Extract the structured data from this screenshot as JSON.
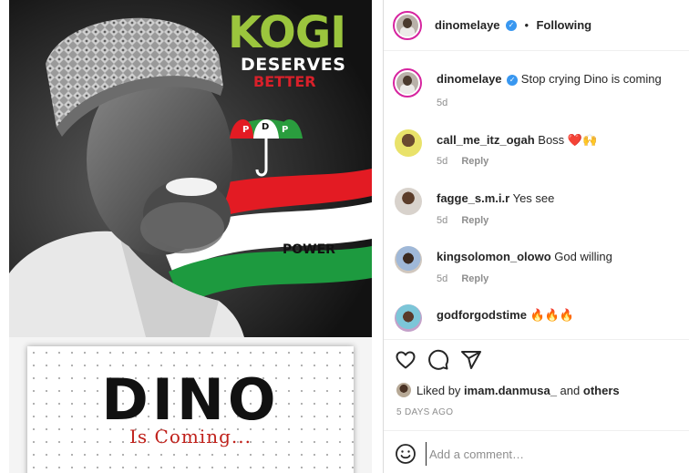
{
  "poster": {
    "headline_1": "KOGI",
    "headline_2": "DESERVES",
    "headline_3": "BETTER",
    "party": "PDP",
    "power_label": "POWER",
    "bottom_title": "DINO",
    "bottom_subtitle": "Is Coming..."
  },
  "header": {
    "username": "dinomelaye",
    "separator": "•",
    "follow_status": "Following",
    "verified": true
  },
  "caption": {
    "username": "dinomelaye",
    "text": "Stop crying Dino is coming",
    "age": "5d"
  },
  "comments": [
    {
      "username": "call_me_itz_ogah",
      "text": "Boss ❤️🙌",
      "age": "5d",
      "reply_label": "Reply"
    },
    {
      "username": "fagge_s.m.i.r",
      "text": "Yes see",
      "age": "5d",
      "reply_label": "Reply"
    },
    {
      "username": "kingsolomon_olowo",
      "text": "God willing",
      "age": "5d",
      "reply_label": "Reply"
    },
    {
      "username": "godforgodstime",
      "text": "🔥🔥🔥"
    }
  ],
  "actions": {
    "icons": [
      "heart-icon",
      "comment-icon",
      "share-icon"
    ]
  },
  "likes": {
    "prefix": "Liked by",
    "user": "imam.danmusa_",
    "middle": "and",
    "others": "others"
  },
  "timestamp": "5 DAYS AGO",
  "add_comment": {
    "placeholder": "Add a comment…"
  },
  "colors": {
    "verified": "#3897f0",
    "story_ring": "#d6249f",
    "kogi_green": "#9bc53d",
    "pdp_red": "#d8202a",
    "text": "#262626",
    "muted": "#8e8e8e"
  }
}
